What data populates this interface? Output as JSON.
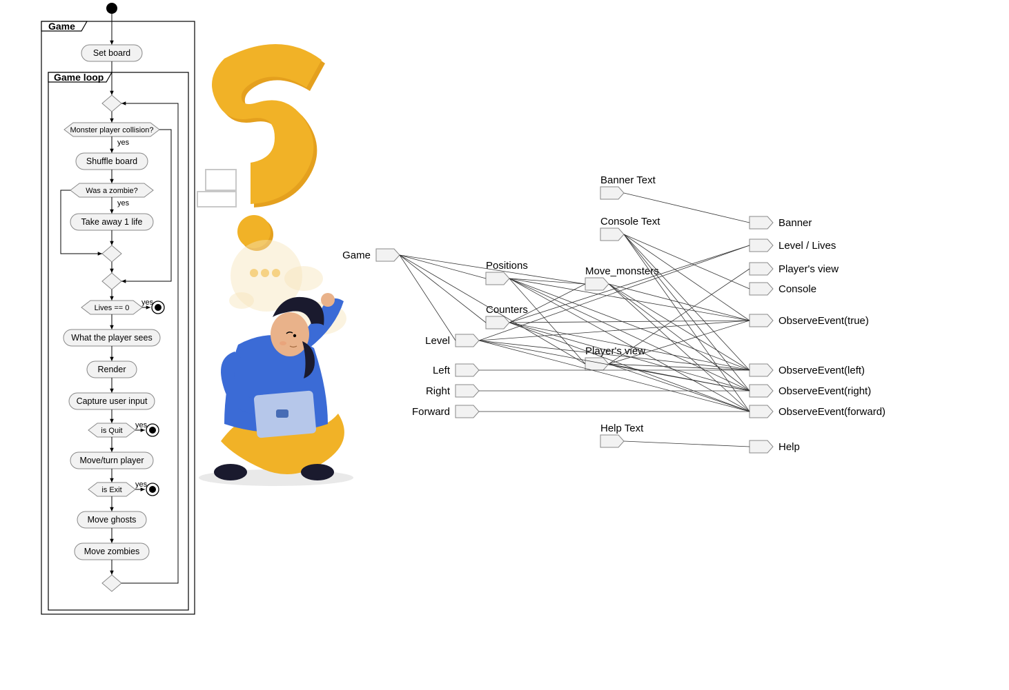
{
  "activity_diagram": {
    "outer_frame": "Game",
    "inner_frame": "Game loop",
    "initial_node": "start",
    "nodes": [
      {
        "id": "set_board",
        "type": "action",
        "label": "Set board"
      },
      {
        "id": "d_merge_top",
        "type": "decision",
        "label": ""
      },
      {
        "id": "d_collision",
        "type": "decision",
        "label": "Monster player collision?"
      },
      {
        "id": "shuffle",
        "type": "action",
        "label": "Shuffle board"
      },
      {
        "id": "d_zombie",
        "type": "decision",
        "label": "Was a zombie?"
      },
      {
        "id": "take_life",
        "type": "action",
        "label": "Take away 1 life"
      },
      {
        "id": "d_merge2",
        "type": "decision",
        "label": ""
      },
      {
        "id": "d_merge3",
        "type": "decision",
        "label": ""
      },
      {
        "id": "d_lives",
        "type": "decision",
        "label": "Lives == 0"
      },
      {
        "id": "final_lives",
        "type": "final",
        "label": ""
      },
      {
        "id": "player_sees",
        "type": "action",
        "label": "What the player sees"
      },
      {
        "id": "render",
        "type": "action",
        "label": "Render"
      },
      {
        "id": "capture",
        "type": "action",
        "label": "Capture user input"
      },
      {
        "id": "d_quit",
        "type": "decision",
        "label": "is Quit"
      },
      {
        "id": "final_quit",
        "type": "final",
        "label": ""
      },
      {
        "id": "move_player",
        "type": "action",
        "label": "Move/turn player"
      },
      {
        "id": "d_exit",
        "type": "decision",
        "label": "is Exit"
      },
      {
        "id": "final_exit",
        "type": "final",
        "label": ""
      },
      {
        "id": "move_ghosts",
        "type": "action",
        "label": "Move ghosts"
      },
      {
        "id": "move_zombies",
        "type": "action",
        "label": "Move zombies"
      },
      {
        "id": "d_loop_back",
        "type": "decision",
        "label": ""
      }
    ],
    "guards": {
      "collision_yes": "yes",
      "zombie_yes": "yes",
      "lives_yes": "yes",
      "quit_yes": "yes",
      "exit_yes": "yes"
    }
  },
  "dependency_graph": {
    "left_nodes": [
      {
        "id": "banner_text",
        "label": "Banner Text"
      },
      {
        "id": "console_text",
        "label": "Console Text"
      },
      {
        "id": "game",
        "label": "Game"
      },
      {
        "id": "positions",
        "label": "Positions"
      },
      {
        "id": "counters",
        "label": "Counters"
      },
      {
        "id": "level",
        "label": "Level"
      },
      {
        "id": "left",
        "label": "Left"
      },
      {
        "id": "right",
        "label": "Right"
      },
      {
        "id": "forward",
        "label": "Forward"
      },
      {
        "id": "help_text",
        "label": "Help Text"
      }
    ],
    "mid_nodes": [
      {
        "id": "move_monsters",
        "label": "Move_monsters"
      },
      {
        "id": "players_view_mid",
        "label": "Player's view"
      }
    ],
    "right_nodes": [
      {
        "id": "banner",
        "label": "Banner"
      },
      {
        "id": "level_lives",
        "label": "Level / Lives"
      },
      {
        "id": "players_view_r",
        "label": "Player's view"
      },
      {
        "id": "console",
        "label": "Console"
      },
      {
        "id": "obs_true",
        "label": "ObserveEvent(true)"
      },
      {
        "id": "obs_left",
        "label": "ObserveEvent(left)"
      },
      {
        "id": "obs_right",
        "label": "ObserveEvent(right)"
      },
      {
        "id": "obs_forward",
        "label": "ObserveEvent(forward)"
      },
      {
        "id": "help",
        "label": "Help"
      }
    ],
    "edges": [
      [
        "banner_text",
        "banner"
      ],
      [
        "console_text",
        "console"
      ],
      [
        "console_text",
        "obs_true"
      ],
      [
        "console_text",
        "obs_left"
      ],
      [
        "console_text",
        "obs_right"
      ],
      [
        "console_text",
        "obs_forward"
      ],
      [
        "game",
        "positions"
      ],
      [
        "game",
        "counters"
      ],
      [
        "game",
        "level"
      ],
      [
        "game",
        "move_monsters"
      ],
      [
        "game",
        "players_view_mid"
      ],
      [
        "positions",
        "move_monsters"
      ],
      [
        "positions",
        "players_view_mid"
      ],
      [
        "positions",
        "obs_true"
      ],
      [
        "positions",
        "obs_left"
      ],
      [
        "positions",
        "obs_right"
      ],
      [
        "positions",
        "obs_forward"
      ],
      [
        "counters",
        "level_lives"
      ],
      [
        "counters",
        "move_monsters"
      ],
      [
        "counters",
        "obs_true"
      ],
      [
        "counters",
        "obs_left"
      ],
      [
        "counters",
        "obs_right"
      ],
      [
        "counters",
        "obs_forward"
      ],
      [
        "level",
        "level_lives"
      ],
      [
        "level",
        "obs_true"
      ],
      [
        "level",
        "obs_left"
      ],
      [
        "level",
        "obs_right"
      ],
      [
        "level",
        "obs_forward"
      ],
      [
        "move_monsters",
        "obs_true"
      ],
      [
        "move_monsters",
        "obs_left"
      ],
      [
        "move_monsters",
        "obs_right"
      ],
      [
        "move_monsters",
        "obs_forward"
      ],
      [
        "players_view_mid",
        "players_view_r"
      ],
      [
        "players_view_mid",
        "obs_true"
      ],
      [
        "players_view_mid",
        "obs_left"
      ],
      [
        "players_view_mid",
        "obs_right"
      ],
      [
        "players_view_mid",
        "obs_forward"
      ],
      [
        "left",
        "obs_left"
      ],
      [
        "right",
        "obs_right"
      ],
      [
        "forward",
        "obs_forward"
      ],
      [
        "help_text",
        "help"
      ]
    ]
  },
  "illustration": {
    "description": "Person sitting cross-legged with laptop pondering a large yellow question mark",
    "question_mark_color": "#f1b227",
    "shirt_color": "#3b6bd6",
    "pants_color": "#f1b227",
    "laptop_color": "#b6c7ea",
    "hair_color": "#1a1a2e"
  }
}
